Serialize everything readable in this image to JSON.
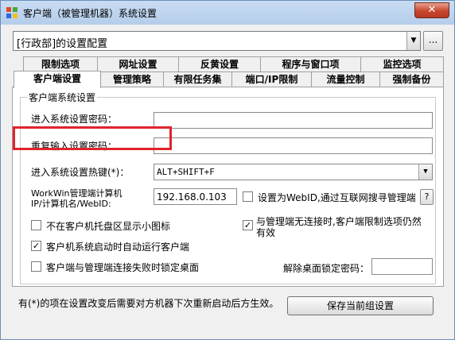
{
  "window": {
    "title": "客户端（被管理机器）系统设置",
    "close_label": "✕"
  },
  "profile": {
    "selected": "[行政部]的设置配置",
    "more_label": "..."
  },
  "tabs": {
    "row1": [
      "限制选项",
      "网址设置",
      "反黄设置",
      "程序与窗口项",
      "监控选项"
    ],
    "row2": [
      "客户端设置",
      "管理策略",
      "有限任务集",
      "端口/IP限制",
      "流量控制",
      "强制备份"
    ],
    "active": "客户端设置"
  },
  "group": {
    "title": "客户端系统设置",
    "password_label": "进入系统设置密码：",
    "password_value": "",
    "repeat_label": "重复输入设置密码：",
    "repeat_value": "",
    "hotkey_label": "进入系统设置热键(*)：",
    "hotkey_value": "ALT+SHIFT+F",
    "server_label_line1": "WorkWin管理端计算机",
    "server_label_line2": "IP/计算机名/WebID:",
    "server_value": "192.168.0.103",
    "webid_label": "设置为WebID,通过互联网搜寻管理端",
    "help_label": "?",
    "hide_tray_label": "不在客户机托盘区显示小图标",
    "disconnect_label": "与管理端无连接时,客户端限制选项仍然有效",
    "autorun_label": "客户机系统启动时自动运行客户端",
    "lock_label": "客户端与管理端连接失败时锁定桌面",
    "unlock_pwd_label": "解除桌面锁定密码：",
    "unlock_pwd_value": ""
  },
  "checkboxes": {
    "webid": false,
    "hide_tray": false,
    "disconnect": true,
    "autorun": true,
    "lock": false
  },
  "footer": {
    "note": "有(*)的项在设置改变后需要对方机器下次重新启动后方生效。",
    "save_label": "保存当前组设置"
  },
  "colors": {
    "highlight": "#e0232e",
    "titlebar": "#b4cdea"
  }
}
